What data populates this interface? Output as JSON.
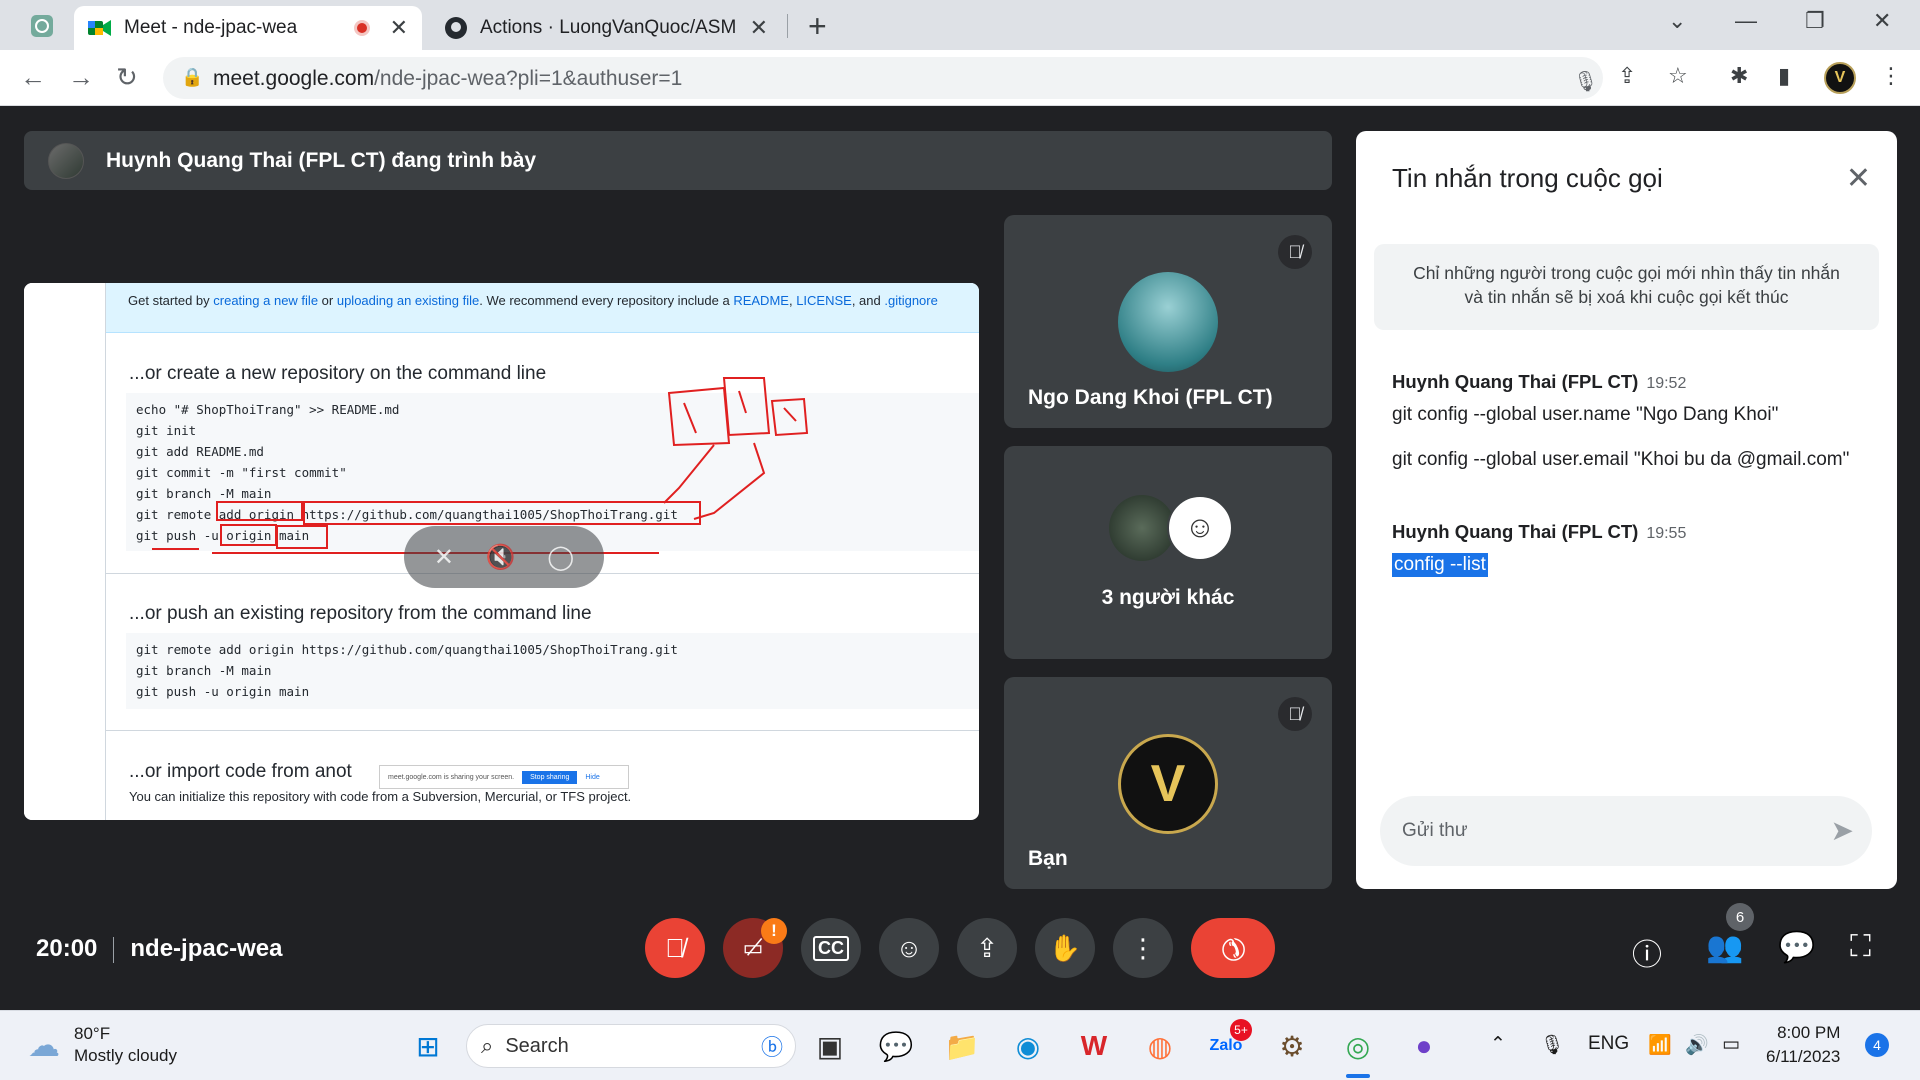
{
  "browser": {
    "tabs": [
      {
        "title": "Meet - nde-jpac-wea",
        "active": true
      },
      {
        "title": "Actions · LuongVanQuoc/ASM",
        "active": false
      }
    ],
    "url_host": "meet.google.com",
    "url_path": "/nde-jpac-wea?pli=1&authuser=1",
    "profile_initial": "V"
  },
  "meet": {
    "presenter_text": "Huynh Quang Thai (FPL CT) đang trình bày",
    "shared_screen": {
      "infobar": {
        "p1": "Get started by ",
        "l1": "creating a new file",
        "p2": " or ",
        "l2": "uploading an existing file",
        "p3": ". We recommend every repository include a ",
        "l3": "README",
        "p4": ", ",
        "l4": "LICENSE",
        "p5": ", and ",
        "l5": ".gitignore"
      },
      "section1_title": "...or create a new repository on the command line",
      "section1_code": [
        "echo \"# ShopThoiTrang\" >> README.md",
        "git init",
        "git add README.md",
        "git commit -m \"first commit\"",
        "git branch -M main",
        "git remote add origin https://github.com/quangthai1005/ShopThoiTrang.git",
        "git push -u origin main"
      ],
      "section2_title": "...or push an existing repository from the command line",
      "section2_code": [
        "git remote add origin https://github.com/quangthai1005/ShopThoiTrang.git",
        "git branch -M main",
        "git push -u origin main"
      ],
      "section3_title": "...or import code from anot",
      "section3_sub": "You can initialize this repository with code from a Subversion, Mercurial, or TFS project.",
      "share_note": "meet.google.com is sharing your screen.",
      "stop_sharing": "Stop sharing",
      "hide": "Hide"
    },
    "participants": [
      {
        "name": "Ngo Dang Khoi (FPL CT)",
        "muted": true
      },
      {
        "name": "3 người khác",
        "muted": false
      },
      {
        "name": "Bạn",
        "muted": true
      }
    ],
    "meeting_time": "20:00",
    "meeting_code": "nde-jpac-wea",
    "participant_count": "6",
    "camera_warning": "!"
  },
  "chat": {
    "title": "Tin nhắn trong cuộc gọi",
    "notice_line1": "Chỉ những người trong cuộc gọi mới nhìn thấy tin nhắn",
    "notice_line2": "và tin nhắn sẽ bị xoá khi cuộc gọi kết thúc",
    "messages": [
      {
        "sender": "Huynh Quang Thai (FPL CT)",
        "time": "19:52",
        "lines": [
          "git config --global user.name \"Ngo Dang Khoi\"",
          "git config --global user.email \"Khoi bu da @gmail.com\""
        ]
      },
      {
        "sender": "Huynh Quang Thai (FPL CT)",
        "time": "19:55",
        "lines": [
          "config --list"
        ]
      }
    ],
    "input_placeholder": "Gửi thư"
  },
  "taskbar": {
    "weather_temp": "80°F",
    "weather_desc": "Mostly cloudy",
    "search_placeholder": "Search",
    "zalo_badge": "5+",
    "language": "ENG",
    "time": "8:00 PM",
    "date": "6/11/2023",
    "notification_count": "4"
  },
  "colors": {
    "meet_bg": "#202124",
    "tile_bg": "#3c4043",
    "hangup_red": "#ea4335",
    "accent_blue": "#1a73e8"
  }
}
